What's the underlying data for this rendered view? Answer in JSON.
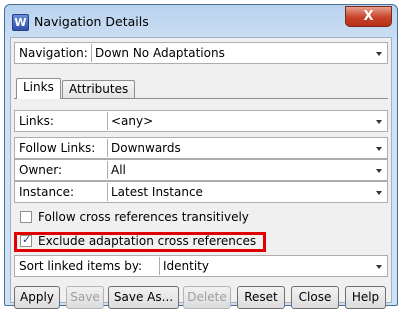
{
  "window": {
    "title": "Navigation Details",
    "app_icon_letter": "W",
    "close_label": "X"
  },
  "navigation": {
    "label": "Navigation:",
    "value": "Down No Adaptations"
  },
  "tabs": [
    {
      "label": "Links"
    },
    {
      "label": "Attributes"
    }
  ],
  "fields": {
    "links": {
      "label": "Links:",
      "value": "<any>"
    },
    "follow_links": {
      "label": "Follow Links:",
      "value": "Downwards"
    },
    "owner": {
      "label": "Owner:",
      "value": "All"
    },
    "instance": {
      "label": "Instance:",
      "value": "Latest Instance"
    }
  },
  "checkboxes": {
    "follow_cross": {
      "label": "Follow cross references transitively",
      "checked": false
    },
    "exclude_adaptation": {
      "label": "Exclude adaptation cross references",
      "checked": true
    }
  },
  "sort": {
    "label": "Sort linked items by:",
    "value": "Identity"
  },
  "buttons": {
    "apply": "Apply",
    "save": "Save",
    "save_as": "Save As...",
    "delete": "Delete",
    "reset": "Reset",
    "close": "Close",
    "help": "Help"
  },
  "colors": {
    "highlight": "#e00000",
    "title_bar": "#cfe1f4",
    "close_button": "#c7432a"
  }
}
